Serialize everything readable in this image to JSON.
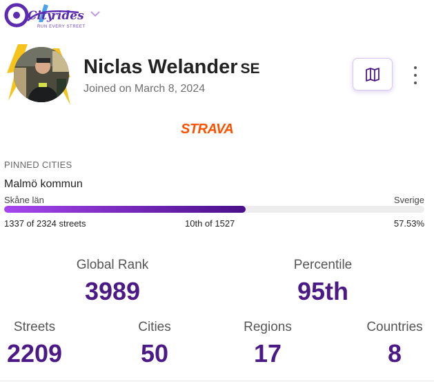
{
  "brand": {
    "name": "CityStrides",
    "tagline": "RUN EVERY STREET"
  },
  "profile": {
    "name": "Niclas Welander",
    "country_code": "SE",
    "joined": "Joined on March 8, 2024",
    "connected_service": "STRAVA"
  },
  "icons": {
    "logo_menu": "chevron-down-icon",
    "map": "map-icon",
    "more": "more-vertical-icon"
  },
  "pinned": {
    "title": "PINNED CITIES",
    "city": "Malmö kommun",
    "region": "Skåne län",
    "country": "Sverige",
    "streets_text": "1337 of 2324 streets",
    "rank_text": "10th of 1527",
    "percent_text": "57.53%",
    "progress": 0.5753
  },
  "stats": {
    "global_rank_label": "Global Rank",
    "global_rank_value": "3989",
    "percentile_label": "Percentile",
    "percentile_value": "95th",
    "streets_label": "Streets",
    "streets_value": "2209",
    "cities_label": "Cities",
    "cities_value": "50",
    "regions_label": "Regions",
    "regions_value": "17",
    "countries_label": "Countries",
    "countries_value": "8"
  },
  "colors": {
    "accent": "#4c1a86",
    "progress_start": "#a646ef",
    "progress_end": "#4a0f8a",
    "strava": "#fc5200"
  }
}
